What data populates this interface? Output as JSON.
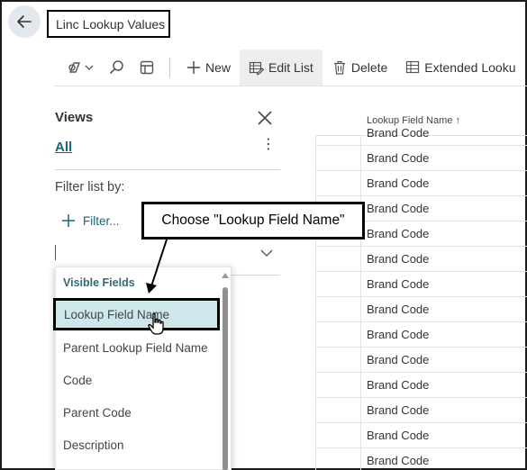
{
  "header": {
    "title": "Linc Lookup Values",
    "back_icon": "arrow-left-icon"
  },
  "toolbar": {
    "new_label": "New",
    "edit_list_label": "Edit List",
    "delete_label": "Delete",
    "extended_label": "Extended Looku"
  },
  "views": {
    "title": "Views",
    "all_label": "All",
    "more": "⋮"
  },
  "filter": {
    "label": "Filter list by:",
    "add_label": "Filter..."
  },
  "dropdown": {
    "header": "Visible Fields",
    "items": [
      "Lookup Field Name",
      "Parent Lookup Field Name",
      "Code",
      "Parent Code",
      "Description"
    ]
  },
  "grid": {
    "column_header": "Lookup Field Name ↑",
    "rows": [
      "Brand Code",
      "Brand Code",
      "Brand Code",
      "Brand Code",
      "Brand Code",
      "Brand Code",
      "Brand Code",
      "Brand Code",
      "Brand Code",
      "Brand Code",
      "Brand Code",
      "Brand Code",
      "Brand Code",
      "Brand Code"
    ]
  },
  "callout": {
    "text": "Choose \"Lookup Field Name\""
  },
  "colors": {
    "accent": "#0f6a7a",
    "selected_bg": "#cde7eb"
  }
}
